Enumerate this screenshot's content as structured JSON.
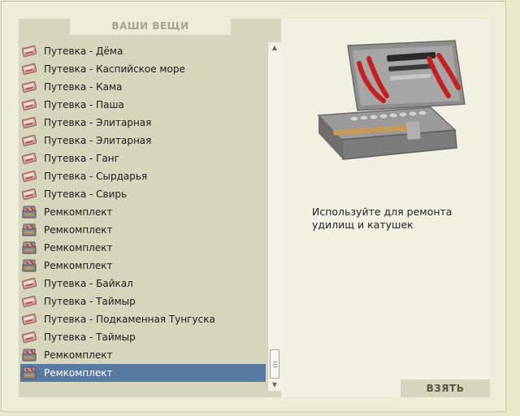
{
  "header": {
    "title": "ВАШИ ВЕЩИ"
  },
  "items": [
    {
      "label": "Путевка - Дёма",
      "icon": "voucher-icon"
    },
    {
      "label": "Путевка - Каспийское море",
      "icon": "voucher-icon"
    },
    {
      "label": "Путевка - Кама",
      "icon": "voucher-icon"
    },
    {
      "label": "Путевка - Паша",
      "icon": "voucher-icon"
    },
    {
      "label": "Путевка - Элитарная",
      "icon": "voucher-icon"
    },
    {
      "label": "Путевка - Элитарная",
      "icon": "voucher-icon"
    },
    {
      "label": "Путевка - Ганг",
      "icon": "voucher-icon"
    },
    {
      "label": "Путевка - Сырдарья",
      "icon": "voucher-icon"
    },
    {
      "label": "Путевка - Свирь",
      "icon": "voucher-icon"
    },
    {
      "label": "Ремкомплект",
      "icon": "repair-kit-icon"
    },
    {
      "label": "Ремкомплект",
      "icon": "repair-kit-icon"
    },
    {
      "label": "Ремкомплект",
      "icon": "repair-kit-icon"
    },
    {
      "label": "Ремкомплект",
      "icon": "repair-kit-icon"
    },
    {
      "label": "Путевка - Байкал",
      "icon": "voucher-icon"
    },
    {
      "label": "Путевка - Таймыр",
      "icon": "voucher-icon"
    },
    {
      "label": "Путевка - Подкаменная Тунгуска",
      "icon": "voucher-icon"
    },
    {
      "label": "Путевка - Таймыр",
      "icon": "voucher-icon"
    },
    {
      "label": "Ремкомплект",
      "icon": "repair-kit-icon"
    },
    {
      "label": "Ремкомплект",
      "icon": "repair-kit-icon",
      "selected": true
    }
  ],
  "detail": {
    "description": "Используйте для ремонта удилищ и катушек",
    "image": "toolbox-image"
  },
  "actions": {
    "take_label": "ВЗЯТЬ"
  },
  "colors": {
    "selection": "#577aa3",
    "list_background": "#d6d6bc",
    "page_background": "#e9e9cd"
  }
}
